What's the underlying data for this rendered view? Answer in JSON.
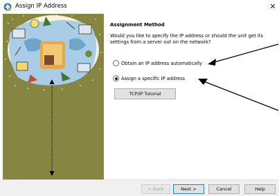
{
  "window": {
    "title": "Assign IP Address",
    "close_label": "✕"
  },
  "page": {
    "heading": "Assignment Method",
    "question": "Would you like to specify the IP address or should the unit get its settings from a server out on the network?",
    "options": [
      {
        "label": "Obtain an IP address automatically",
        "selected": false
      },
      {
        "label": "Assign a specific IP address",
        "selected": true
      }
    ],
    "tutorial_button": "TCP/IP Tutorial"
  },
  "buttons": {
    "back": "< Back",
    "next": "Next >",
    "cancel": "Cancel",
    "help": "Help"
  },
  "colors": {
    "left_panel": "#868541",
    "arrow": "#000000",
    "default_button_border": "#2a7ed3"
  },
  "icons": {
    "app": "network-wizard-icon",
    "close": "close-icon",
    "panel": "network-collage-illustration"
  }
}
